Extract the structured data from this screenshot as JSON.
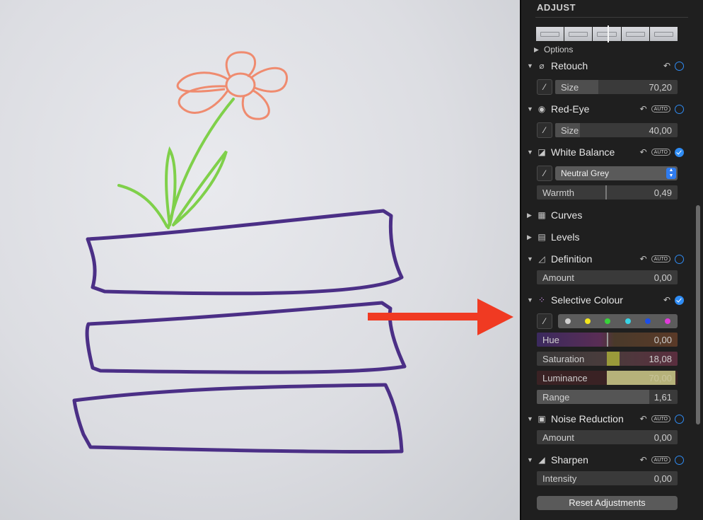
{
  "panel": {
    "title": "ADJUST",
    "options_label": "Options",
    "reset_label": "Reset Adjustments"
  },
  "sections": {
    "retouch": {
      "label": "Retouch",
      "enabled": false,
      "size": {
        "label": "Size",
        "value": "70,20",
        "level": 0.35
      }
    },
    "red_eye": {
      "label": "Red-Eye",
      "auto_label": "AUTO",
      "enabled": false,
      "size": {
        "label": "Size",
        "value": "40,00",
        "level": 0.2
      }
    },
    "white_balance": {
      "label": "White Balance",
      "auto_label": "AUTO",
      "enabled": true,
      "mode": "Neutral Grey",
      "warmth": {
        "label": "Warmth",
        "value": "0,49",
        "level": 0.49
      }
    },
    "curves": {
      "label": "Curves"
    },
    "levels": {
      "label": "Levels"
    },
    "definition": {
      "label": "Definition",
      "auto_label": "AUTO",
      "enabled": false,
      "amount": {
        "label": "Amount",
        "value": "0,00"
      }
    },
    "selective_colour": {
      "label": "Selective Colour",
      "enabled": true,
      "swatch_colors": [
        "#d0d0d0",
        "#f3e61d",
        "#38d23a",
        "#39d4e6",
        "#1c4fe8",
        "#e03ad9"
      ],
      "hue": {
        "label": "Hue",
        "value": "0,00",
        "level": 0.5
      },
      "saturation": {
        "label": "Saturation",
        "value": "18,08",
        "level": 0.59
      },
      "luminance": {
        "label": "Luminance",
        "value": "70,00",
        "level": 0.85
      },
      "range": {
        "label": "Range",
        "value": "1,61",
        "level": 0.8
      }
    },
    "noise_reduction": {
      "label": "Noise Reduction",
      "auto_label": "AUTO",
      "enabled": false,
      "amount": {
        "label": "Amount",
        "value": "0,00"
      }
    },
    "sharpen": {
      "label": "Sharpen",
      "auto_label": "AUTO",
      "enabled": false,
      "intensity": {
        "label": "Intensity",
        "value": "0,00"
      }
    }
  },
  "colors": {
    "accent": "#2f8cf4",
    "arrow": "#f03a22"
  }
}
